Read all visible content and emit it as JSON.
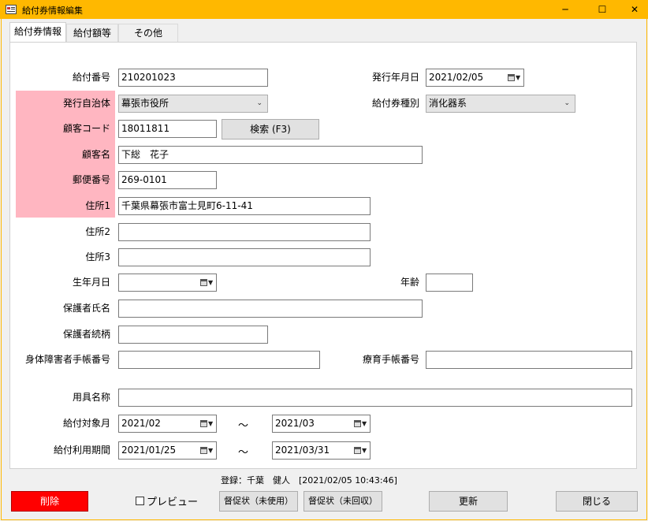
{
  "window": {
    "title": "給付券情報編集",
    "minimize": "─",
    "maximize": "☐",
    "close": "✕",
    "title_bar_color": "#ffb800"
  },
  "tabs": [
    {
      "label": "給付券情報",
      "active": true
    },
    {
      "label": "給付額等",
      "active": false
    },
    {
      "label": "その他",
      "active": false
    }
  ],
  "form": {
    "kyufu_no": {
      "label": "給付番号",
      "value": "210201023"
    },
    "hakko_date": {
      "label": "発行年月日",
      "value": "2021/02/05"
    },
    "jichitai": {
      "label": "発行自治体",
      "value": "幕張市役所"
    },
    "kyufu_shubetsu": {
      "label": "給付券種別",
      "value": "消化器系"
    },
    "kokyaku_code": {
      "label": "顧客コード",
      "value": "18011811"
    },
    "search_button": "検索 (F3)",
    "kokyaku_name": {
      "label": "顧客名",
      "value": "下総　花子"
    },
    "yubin": {
      "label": "郵便番号",
      "value": "269-0101"
    },
    "address1": {
      "label": "住所1",
      "value": "千葉県幕張市富士見町6-11-41"
    },
    "address2": {
      "label": "住所2",
      "value": ""
    },
    "address3": {
      "label": "住所3",
      "value": ""
    },
    "birthday": {
      "label": "生年月日",
      "value": ""
    },
    "age": {
      "label": "年齢",
      "value": ""
    },
    "guardian_name": {
      "label": "保護者氏名",
      "value": ""
    },
    "guardian_relation": {
      "label": "保護者続柄",
      "value": ""
    },
    "shintai_techo": {
      "label": "身体障害者手帳番号",
      "value": ""
    },
    "ryoiku_techo": {
      "label": "療育手帳番号",
      "value": ""
    },
    "yogu_name": {
      "label": "用具名称",
      "value": ""
    },
    "taisho_month": {
      "label": "給付対象月",
      "from": "2021/02",
      "separator": "～",
      "to": "2021/03"
    },
    "riyo_period": {
      "label": "給付利用期間",
      "from": "2021/01/25",
      "separator": "～",
      "to": "2021/03/31"
    }
  },
  "status": "登録：千葉　健人　[2021/02/05 10:43:46]",
  "footer": {
    "delete": "削除",
    "preview": "プレビュー",
    "preview_checked": false,
    "tokusoku_unused": "督促状（未使用）",
    "tokusoku_uncollected": "督促状（未回収）",
    "update": "更新",
    "close": "閉じる"
  },
  "colors": {
    "required_highlight": "#ffb6c1",
    "delete_button": "#ff0000"
  }
}
